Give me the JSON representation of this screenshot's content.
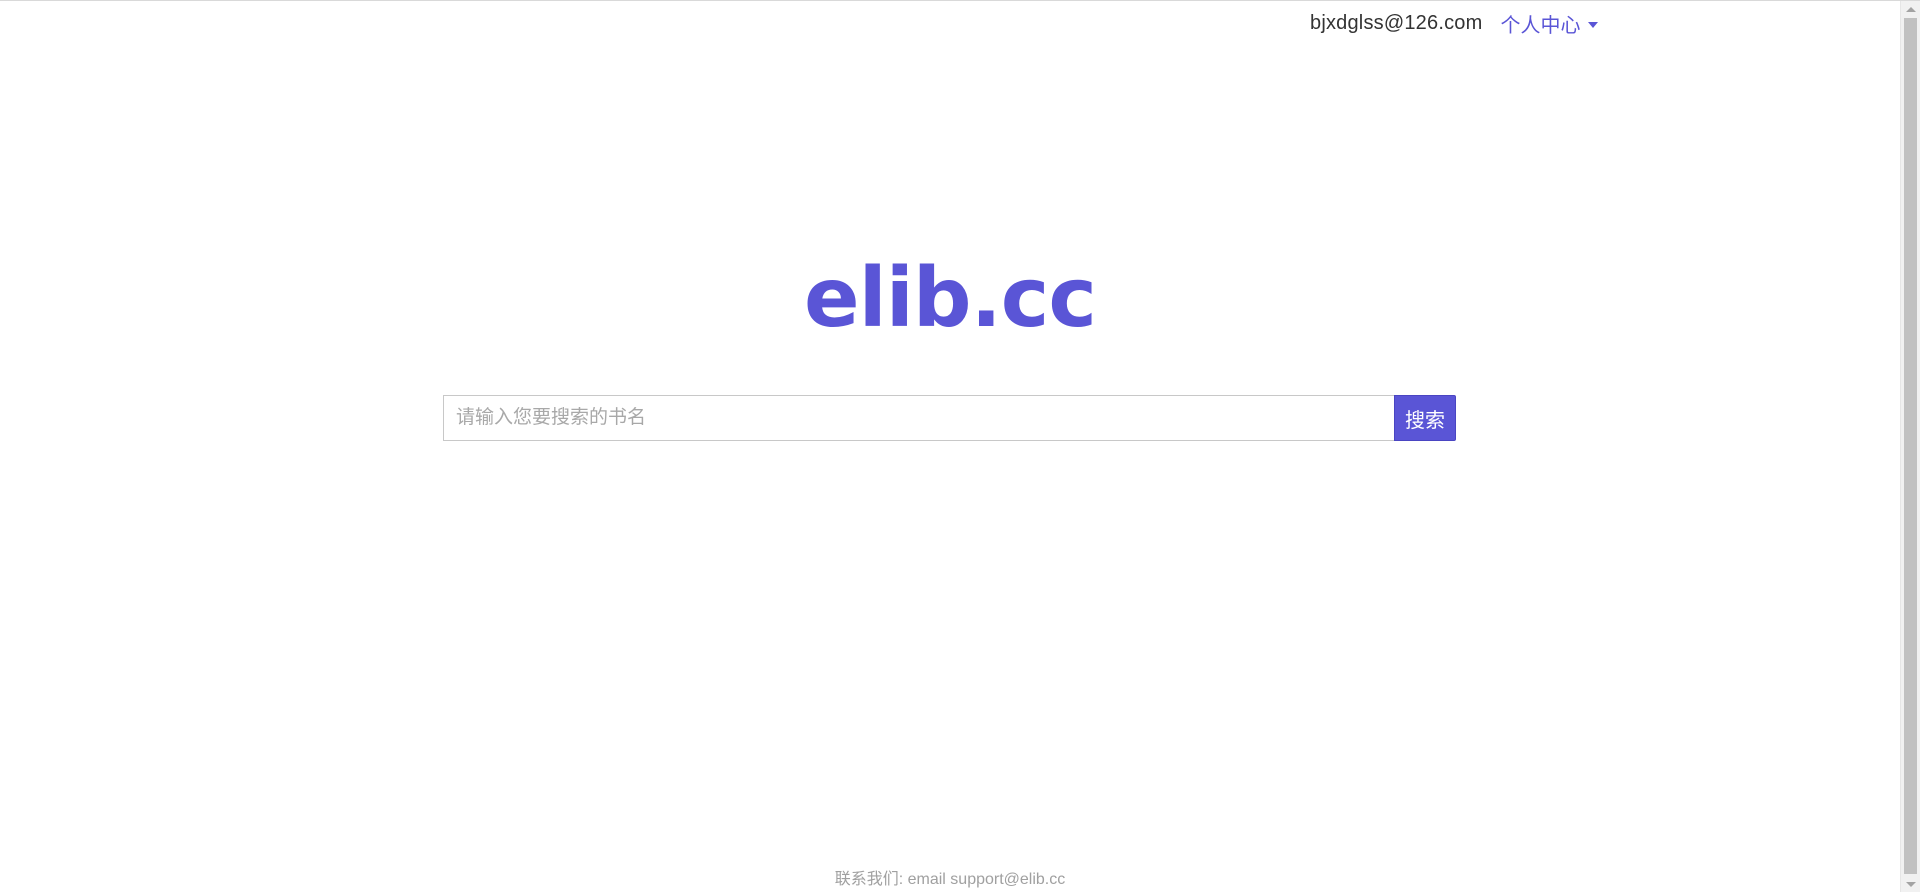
{
  "header": {
    "user_email": "bjxdglss@126.com",
    "user_center_label": "个人中心",
    "user_center_icon": "caret-down-icon"
  },
  "logo": {
    "text": "elib.cc"
  },
  "search": {
    "placeholder": "请输入您要搜索的书名",
    "value": "",
    "button_label": "搜索"
  },
  "footer": {
    "contact_text": "联系我们: email support@elib.cc"
  },
  "colors": {
    "brand": "#5a55d6",
    "footer_text": "#a0a0a0",
    "input_border": "#c8c8c8"
  }
}
